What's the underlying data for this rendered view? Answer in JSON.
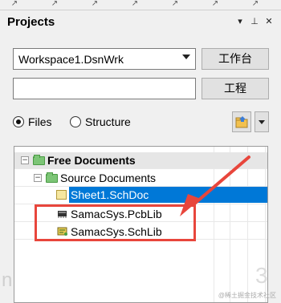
{
  "toolbar": {
    "icons": [
      "arrow-tool-icon",
      "arrow-tool-icon",
      "arrow-tool-icon",
      "arrow-tool-icon",
      "arrow-tool-icon",
      "arrow-tool-icon",
      "arrow-tool-icon"
    ]
  },
  "panel": {
    "title": "Projects",
    "header_buttons": {
      "dropdown": "▾",
      "pin": "⊥",
      "close": "✕"
    }
  },
  "workspace": {
    "combo_value": "Workspace1.DsnWrk",
    "workspace_button": "工作台",
    "project_button": "工程",
    "project_field_value": ""
  },
  "view_mode": {
    "options": [
      {
        "label": "Files",
        "selected": true
      },
      {
        "label": "Structure",
        "selected": false
      }
    ]
  },
  "tree": {
    "root": {
      "label": "Free Documents",
      "expanded": "−"
    },
    "group": {
      "label": "Source Documents",
      "expanded": "−"
    },
    "items": [
      {
        "label": "Sheet1.SchDoc",
        "icon": "schdoc-icon",
        "selected": true
      },
      {
        "label": "SamacSys.PcbLib",
        "icon": "pcblib-icon",
        "selected": false
      },
      {
        "label": "SamacSys.SchLib",
        "icon": "schlib-icon",
        "selected": false
      }
    ]
  },
  "colors": {
    "selection": "#0078d7",
    "annotation": "#e8463c",
    "folder": "#7cc576"
  },
  "watermark": "@稀土掘金技术社区"
}
